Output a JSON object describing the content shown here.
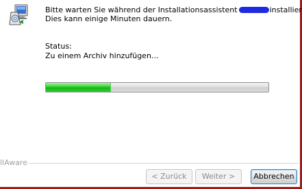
{
  "dialog": {
    "message_part1": "Bitte warten Sie während der Installationsassistent",
    "message_part2": "installiert.",
    "message_line2": "Dies kann einige Minuten dauern.",
    "status_label": "Status:",
    "status_text": "Zu einem Archiv hinzufügen...",
    "progress_fraction": 0.29,
    "icon_name": "installer-computer-icon",
    "redaction_color": "#1f2be0"
  },
  "branding": {
    "text": "llAware"
  },
  "buttons": {
    "back": "< Zurück",
    "next": "Weiter >",
    "cancel": "Abbrechen"
  },
  "colors": {
    "progress_green": "#22c322",
    "frame_red": "#9b1b1b",
    "focus_blue": "#3c7fb1"
  }
}
